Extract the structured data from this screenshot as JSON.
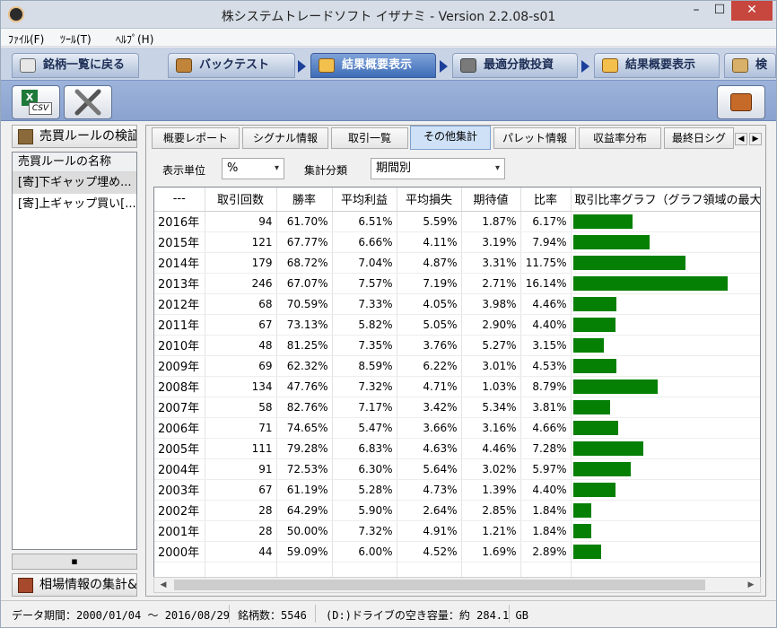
{
  "window": {
    "title": "株システムトレードソフト イザナミ - Version 2.2.08-s01",
    "min_label": "–",
    "max_label": "☐",
    "close_label": "✕"
  },
  "menu": {
    "file": "ﾌｧｲﾙ(F)",
    "tool": "ﾂｰﾙ(T)",
    "help": "ﾍﾙﾌﾟ(H)"
  },
  "flow": {
    "tabs": [
      {
        "label": "銘柄一覧に戻る",
        "icon": "gear-icon"
      },
      {
        "label": "バックテスト",
        "icon": "bag-icon"
      },
      {
        "label": "結果概要表示",
        "icon": "chart-hand-icon"
      },
      {
        "label": "最適分散投資",
        "icon": "calculator-icon"
      },
      {
        "label": "結果概要表示",
        "icon": "chart-hand-icon"
      },
      {
        "label": "検",
        "icon": "pencil-icon"
      }
    ]
  },
  "toolbar": {
    "csv_label": "CSV",
    "colors": {
      "accent": "#3d6cb7",
      "bar": "#058005"
    }
  },
  "leftpanel": {
    "title": "売買ルールの検証",
    "list_header": "売買ルールの名称",
    "items": [
      "[寄]下ギャップ埋め...",
      "[寄]上ギャップ買い[..."
    ],
    "bottom": "相場情報の集計&"
  },
  "tabs": [
    "概要レポート",
    "シグナル情報",
    "取引一覧",
    "その他集計",
    "パレット情報",
    "収益率分布",
    "最終日シグ"
  ],
  "controls": {
    "unit_label": "表示単位",
    "unit_value": "%",
    "group_label": "集計分類",
    "group_value": "期間別"
  },
  "table": {
    "headers": [
      "---",
      "取引回数",
      "勝率",
      "平均利益",
      "平均損失",
      "期待値",
      "比率",
      "取引比率グラフ（グラフ領域の最大"
    ],
    "rows": [
      {
        "year": "2016年",
        "trades": "94",
        "winrate": "61.70%",
        "avg_profit": "6.51%",
        "avg_loss": "5.59%",
        "expect": "1.87%",
        "ratio": "6.17%",
        "ratio_value": 6.17
      },
      {
        "year": "2015年",
        "trades": "121",
        "winrate": "67.77%",
        "avg_profit": "6.66%",
        "avg_loss": "4.11%",
        "expect": "3.19%",
        "ratio": "7.94%",
        "ratio_value": 7.94
      },
      {
        "year": "2014年",
        "trades": "179",
        "winrate": "68.72%",
        "avg_profit": "7.04%",
        "avg_loss": "4.87%",
        "expect": "3.31%",
        "ratio": "11.75%",
        "ratio_value": 11.75
      },
      {
        "year": "2013年",
        "trades": "246",
        "winrate": "67.07%",
        "avg_profit": "7.57%",
        "avg_loss": "7.19%",
        "expect": "2.71%",
        "ratio": "16.14%",
        "ratio_value": 16.14
      },
      {
        "year": "2012年",
        "trades": "68",
        "winrate": "70.59%",
        "avg_profit": "7.33%",
        "avg_loss": "4.05%",
        "expect": "3.98%",
        "ratio": "4.46%",
        "ratio_value": 4.46
      },
      {
        "year": "2011年",
        "trades": "67",
        "winrate": "73.13%",
        "avg_profit": "5.82%",
        "avg_loss": "5.05%",
        "expect": "2.90%",
        "ratio": "4.40%",
        "ratio_value": 4.4
      },
      {
        "year": "2010年",
        "trades": "48",
        "winrate": "81.25%",
        "avg_profit": "7.35%",
        "avg_loss": "3.76%",
        "expect": "5.27%",
        "ratio": "3.15%",
        "ratio_value": 3.15
      },
      {
        "year": "2009年",
        "trades": "69",
        "winrate": "62.32%",
        "avg_profit": "8.59%",
        "avg_loss": "6.22%",
        "expect": "3.01%",
        "ratio": "4.53%",
        "ratio_value": 4.53
      },
      {
        "year": "2008年",
        "trades": "134",
        "winrate": "47.76%",
        "avg_profit": "7.32%",
        "avg_loss": "4.71%",
        "expect": "1.03%",
        "ratio": "8.79%",
        "ratio_value": 8.79
      },
      {
        "year": "2007年",
        "trades": "58",
        "winrate": "82.76%",
        "avg_profit": "7.17%",
        "avg_loss": "3.42%",
        "expect": "5.34%",
        "ratio": "3.81%",
        "ratio_value": 3.81
      },
      {
        "year": "2006年",
        "trades": "71",
        "winrate": "74.65%",
        "avg_profit": "5.47%",
        "avg_loss": "3.66%",
        "expect": "3.16%",
        "ratio": "4.66%",
        "ratio_value": 4.66
      },
      {
        "year": "2005年",
        "trades": "111",
        "winrate": "79.28%",
        "avg_profit": "6.83%",
        "avg_loss": "4.63%",
        "expect": "4.46%",
        "ratio": "7.28%",
        "ratio_value": 7.28
      },
      {
        "year": "2004年",
        "trades": "91",
        "winrate": "72.53%",
        "avg_profit": "6.30%",
        "avg_loss": "5.64%",
        "expect": "3.02%",
        "ratio": "5.97%",
        "ratio_value": 5.97
      },
      {
        "year": "2003年",
        "trades": "67",
        "winrate": "61.19%",
        "avg_profit": "5.28%",
        "avg_loss": "4.73%",
        "expect": "1.39%",
        "ratio": "4.40%",
        "ratio_value": 4.4
      },
      {
        "year": "2002年",
        "trades": "28",
        "winrate": "64.29%",
        "avg_profit": "5.90%",
        "avg_loss": "2.64%",
        "expect": "2.85%",
        "ratio": "1.84%",
        "ratio_value": 1.84
      },
      {
        "year": "2001年",
        "trades": "28",
        "winrate": "50.00%",
        "avg_profit": "7.32%",
        "avg_loss": "4.91%",
        "expect": "1.21%",
        "ratio": "1.84%",
        "ratio_value": 1.84
      },
      {
        "year": "2000年",
        "trades": "44",
        "winrate": "59.09%",
        "avg_profit": "6.00%",
        "avg_loss": "4.52%",
        "expect": "1.69%",
        "ratio": "2.89%",
        "ratio_value": 2.89
      }
    ]
  },
  "status": {
    "period": "データ期間：2000/01/04 〜 2016/08/29",
    "count": "銘柄数：5546",
    "disk": "(D:)ドライブの空き容量：約 284.1 GB"
  }
}
